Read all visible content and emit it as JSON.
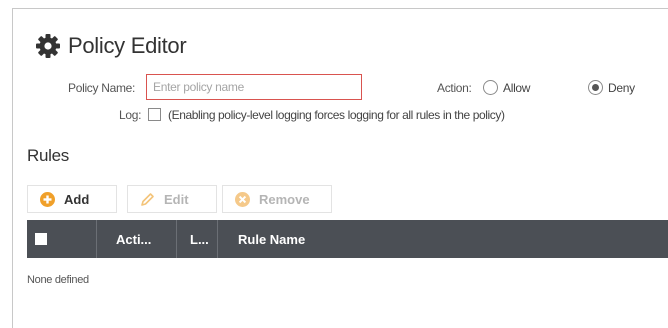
{
  "header": {
    "title": "Policy Editor",
    "icon": "gear-icon"
  },
  "form": {
    "policy_name_label": "Policy Name:",
    "policy_name_value": "",
    "policy_name_placeholder": "Enter policy name",
    "action_label": "Action:",
    "action_options": [
      "Allow",
      "Deny"
    ],
    "action_selected": "Deny",
    "log_label": "Log:",
    "log_checked": false,
    "log_note": "(Enabling policy-level logging forces logging for all rules in the policy)"
  },
  "rules": {
    "section_title": "Rules",
    "toolbar": {
      "add_label": "Add",
      "edit_label": "Edit",
      "remove_label": "Remove"
    },
    "columns": [
      "Acti...",
      "L...",
      "Rule Name"
    ],
    "empty_text": "None defined"
  },
  "colors": {
    "accent_orange": "#f0a02a",
    "error_border": "#d9534f",
    "header_bg": "#4b4f55",
    "disabled_text": "#b5b5b5"
  }
}
